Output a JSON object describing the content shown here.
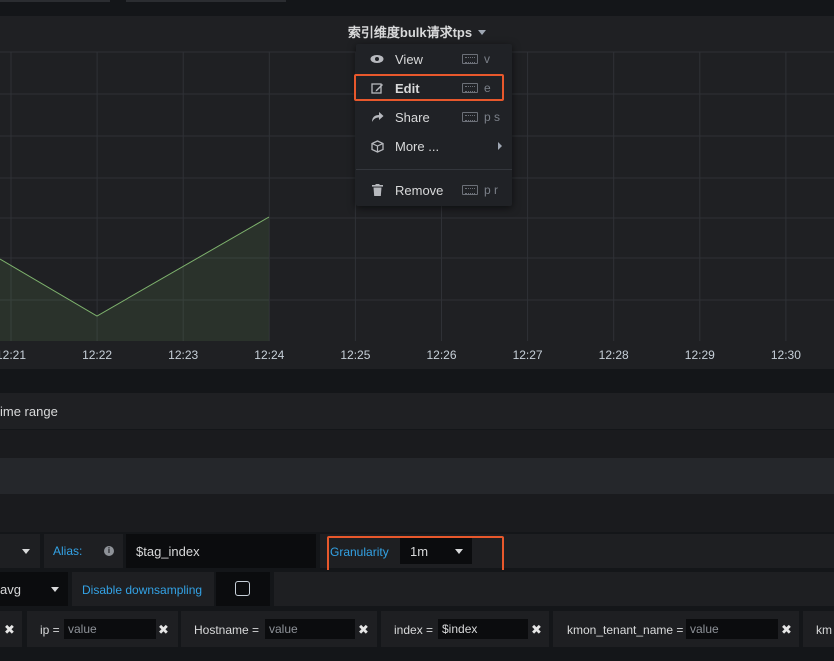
{
  "panel": {
    "title": "索引维度bulk请求tps",
    "x_ticks": [
      "12:21",
      "12:22",
      "12:23",
      "12:24",
      "12:25",
      "12:26",
      "12:27",
      "12:28",
      "12:29",
      "12:30"
    ],
    "series_color": "#7eb26d"
  },
  "context_menu": {
    "items": [
      {
        "label": "View",
        "key": "v",
        "icon": "eye-icon"
      },
      {
        "label": "Edit",
        "key": "e",
        "icon": "edit-icon"
      },
      {
        "label": "Share",
        "key": "p s",
        "icon": "share-icon"
      },
      {
        "label": "More ...",
        "key": "",
        "icon": "cube-icon"
      },
      {
        "label": "Remove",
        "key": "p r",
        "icon": "trash-icon"
      }
    ],
    "highlight_color": "#e8582c"
  },
  "editor": {
    "time_range_text": "ime range",
    "alias_label": "Alias:",
    "alias_value": "$tag_index",
    "granularity_label": "Granularity",
    "granularity_value": "1m",
    "aggregator_value": "avg",
    "downsampling_label": "Disable downsampling",
    "tags": [
      {
        "key": "ip =",
        "value": "value",
        "filled": false
      },
      {
        "key": "Hostname =",
        "value": "value",
        "filled": false
      },
      {
        "key": "index =",
        "value": "$index",
        "filled": true
      },
      {
        "key": "kmon_tenant_name =",
        "value": "value",
        "filled": false
      }
    ],
    "trailing_tag_key": "km"
  }
}
